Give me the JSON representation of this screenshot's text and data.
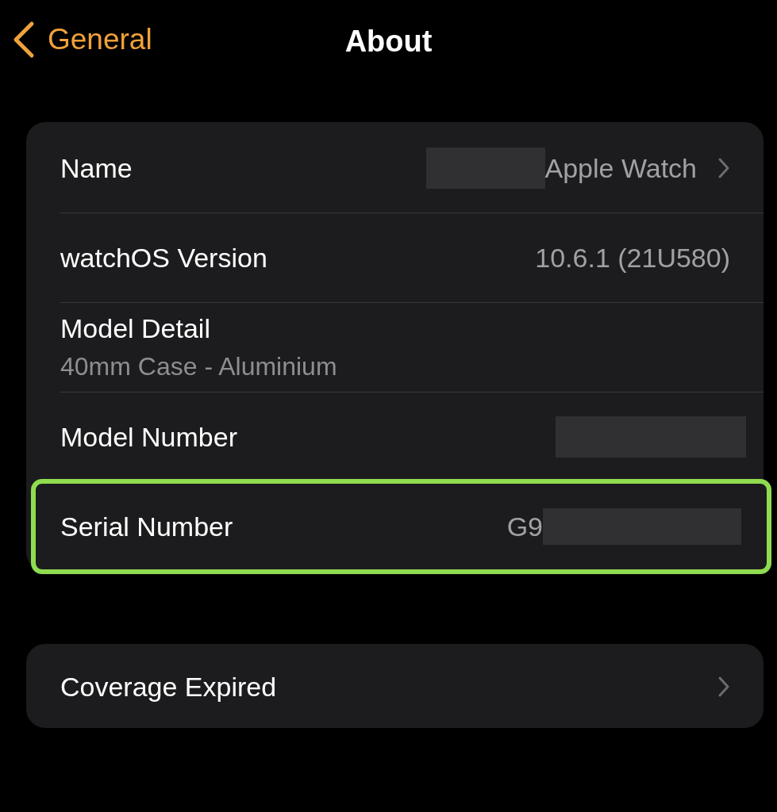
{
  "nav": {
    "back_label": "General",
    "title": "About"
  },
  "groups": [
    {
      "rows": [
        {
          "kind": "value",
          "label": "Name",
          "value": "Apple Watch",
          "redacted_before": true,
          "chevron": true,
          "highlighted": false
        },
        {
          "kind": "value",
          "label": "watchOS Version",
          "value": "10.6.1 (21U580)",
          "chevron": false,
          "highlighted": false
        },
        {
          "kind": "subtitle",
          "label": "Model Detail",
          "subtitle": "40mm Case - Aluminium",
          "chevron": false,
          "highlighted": false
        },
        {
          "kind": "redacted",
          "label": "Model Number",
          "chevron": false,
          "highlighted": false
        },
        {
          "kind": "value",
          "label": "Serial Number",
          "value": "G9",
          "redacted_after": true,
          "chevron": false,
          "highlighted": true
        }
      ]
    },
    {
      "rows": [
        {
          "kind": "plain",
          "label": "Coverage Expired",
          "chevron": true,
          "highlighted": false
        }
      ]
    }
  ]
}
